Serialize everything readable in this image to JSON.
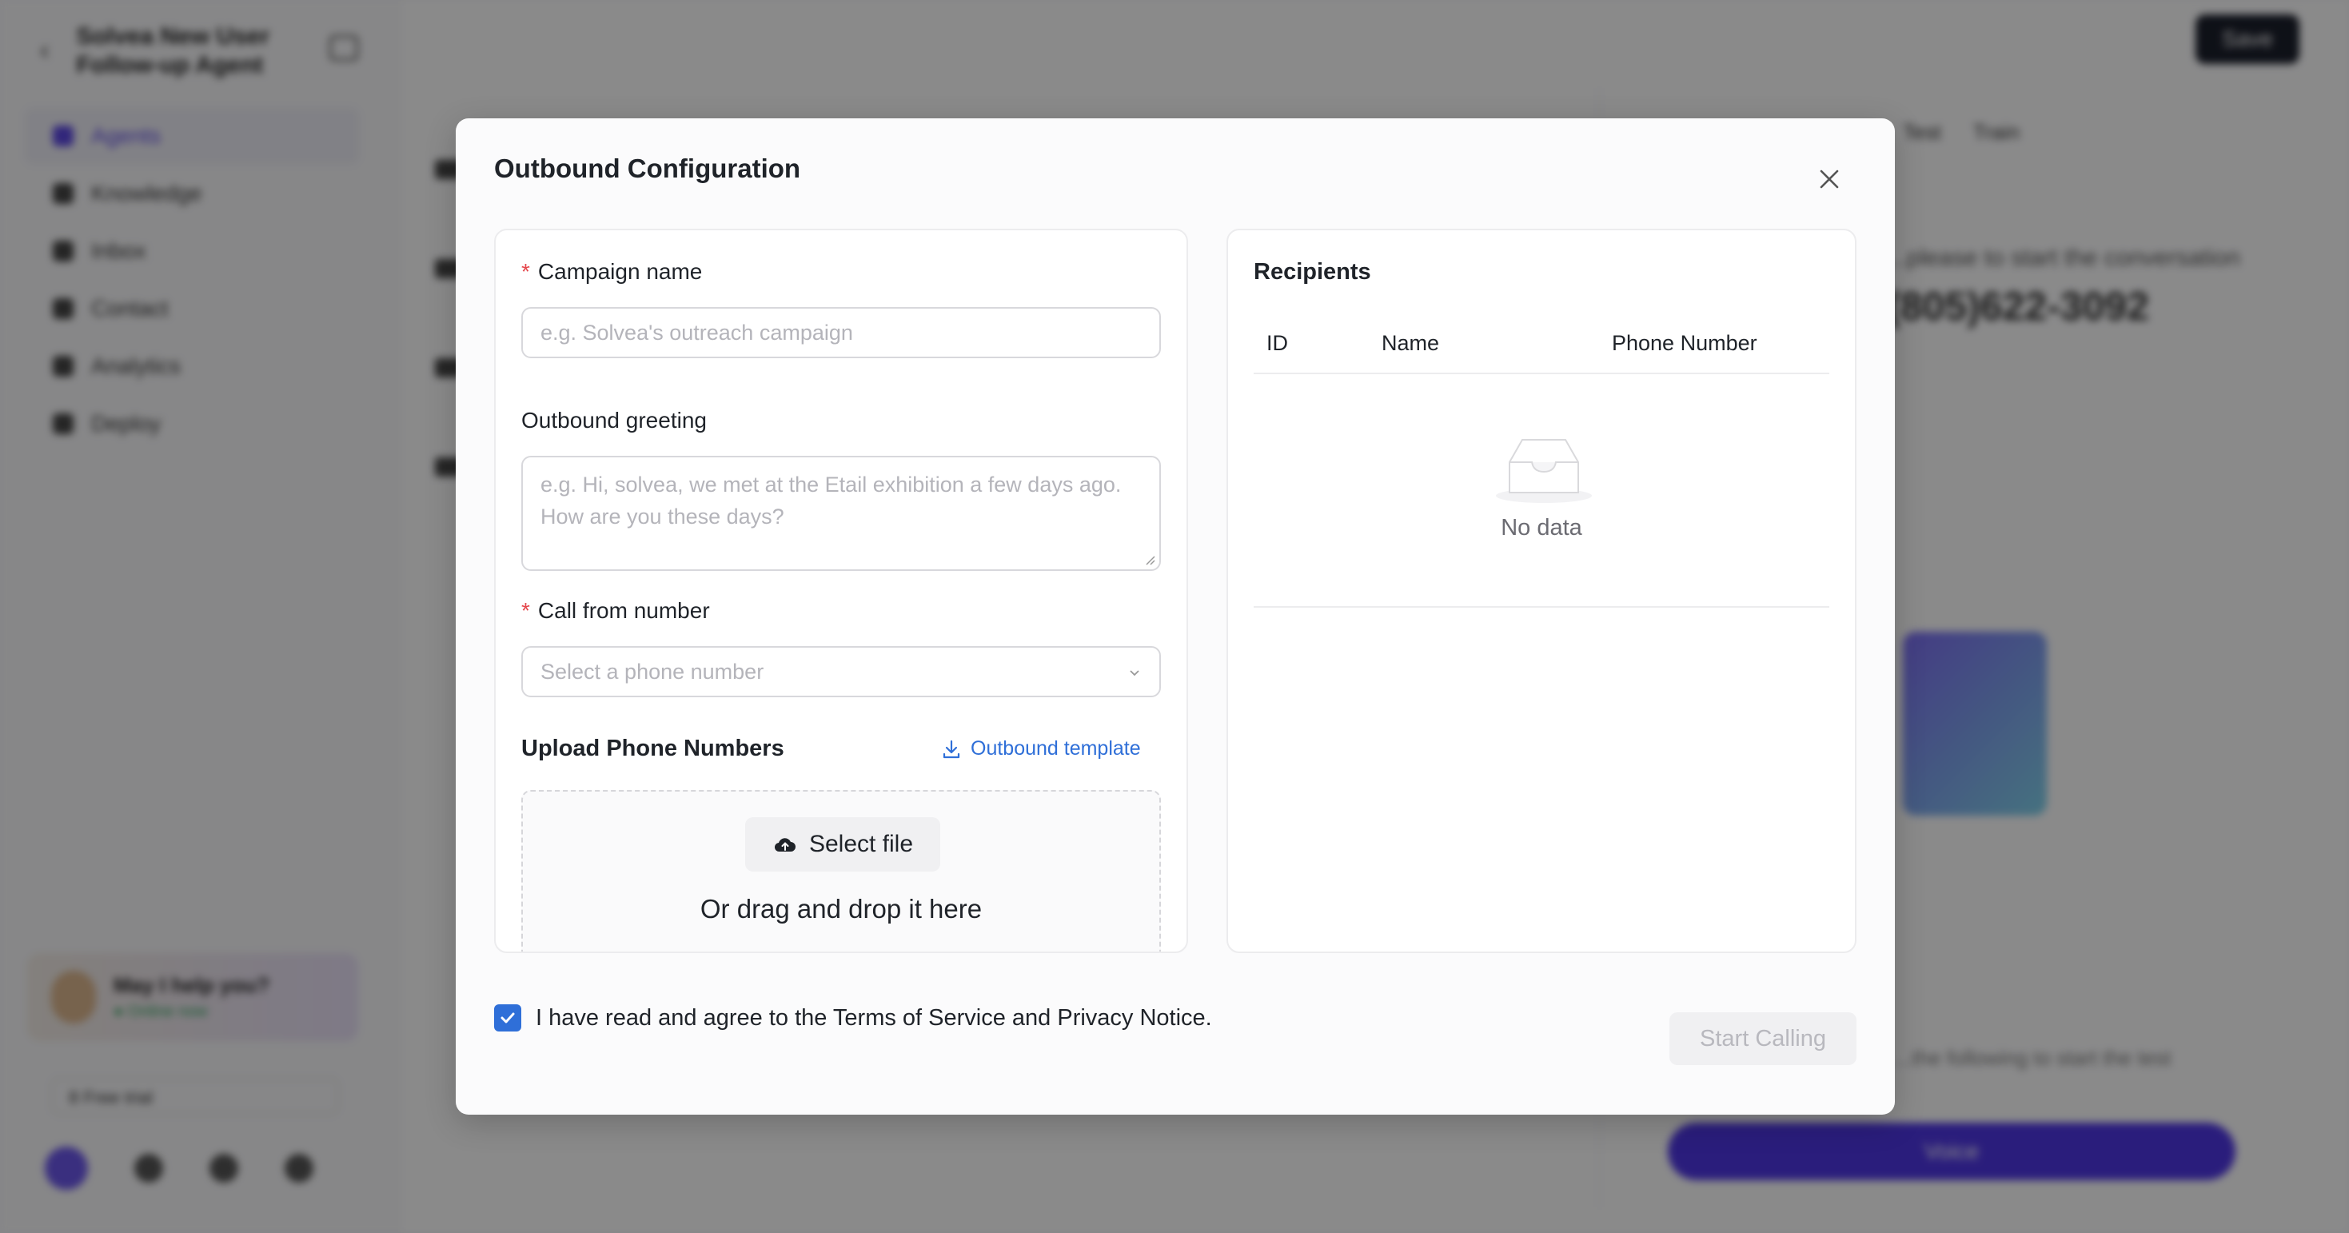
{
  "background": {
    "sidebar": {
      "title": "Solvea New User Follow-up Agent",
      "nav_items": [
        "Agents",
        "Knowledge",
        "Inbox",
        "Contact",
        "Analytics",
        "Deploy"
      ],
      "help_title": "May I help you?",
      "help_status": "● Online now",
      "trial_label": "8 Free trial"
    },
    "save_label": "Save",
    "tabs": [
      "Test",
      "Train"
    ],
    "conversation_hint": "...please to start the conversation",
    "phone_number": "(805)622-3092",
    "footer_hint": "...the following to start the test",
    "voice_label": "Voice"
  },
  "modal": {
    "title": "Outbound Configuration",
    "campaign_name": {
      "label": "Campaign name",
      "placeholder": "e.g. Solvea's outreach campaign"
    },
    "greeting": {
      "label": "Outbound greeting",
      "placeholder": "e.g. Hi, solvea, we met at the Etail exhibition a few days ago. How are you these days?"
    },
    "call_from": {
      "label": "Call from number",
      "placeholder": "Select a phone number"
    },
    "upload": {
      "title": "Upload Phone Numbers",
      "template_link": "Outbound template",
      "select_file": "Select file",
      "drag_text": "Or drag and drop it here"
    },
    "recipients": {
      "title": "Recipients",
      "columns": [
        "ID",
        "Name",
        "Phone Number"
      ],
      "rows": [],
      "empty_text": "No data"
    },
    "agree_text": "I have read and agree to the Terms of Service and Privacy Notice.",
    "agree_checked": true,
    "start_button": "Start Calling"
  },
  "colors": {
    "accent": "#2f6fd8",
    "required": "#e5484d",
    "brand_purple": "#4e36e2"
  }
}
